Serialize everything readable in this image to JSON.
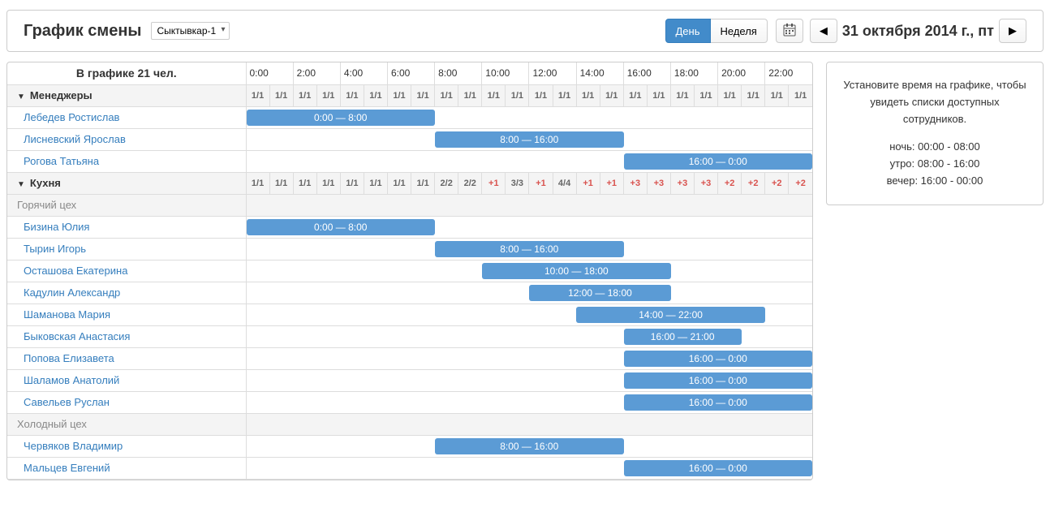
{
  "toolbar": {
    "title": "График смены",
    "location": "Сыктывкар-1",
    "view_day": "День",
    "view_week": "Неделя",
    "date": "31 октября 2014 г., пт"
  },
  "header": {
    "summary": "В графике 21 чел.",
    "times": [
      "0:00",
      "2:00",
      "4:00",
      "6:00",
      "8:00",
      "10:00",
      "12:00",
      "14:00",
      "16:00",
      "18:00",
      "20:00",
      "22:00"
    ]
  },
  "groups": [
    {
      "name": "Менеджеры",
      "counters": [
        {
          "v": "1/1"
        },
        {
          "v": "1/1"
        },
        {
          "v": "1/1"
        },
        {
          "v": "1/1"
        },
        {
          "v": "1/1"
        },
        {
          "v": "1/1"
        },
        {
          "v": "1/1"
        },
        {
          "v": "1/1"
        },
        {
          "v": "1/1"
        },
        {
          "v": "1/1"
        },
        {
          "v": "1/1"
        },
        {
          "v": "1/1"
        },
        {
          "v": "1/1"
        },
        {
          "v": "1/1"
        },
        {
          "v": "1/1"
        },
        {
          "v": "1/1"
        },
        {
          "v": "1/1"
        },
        {
          "v": "1/1"
        },
        {
          "v": "1/1"
        },
        {
          "v": "1/1"
        },
        {
          "v": "1/1"
        },
        {
          "v": "1/1"
        },
        {
          "v": "1/1"
        },
        {
          "v": "1/1"
        }
      ],
      "rows": [
        {
          "name": "Лебедев Ростислав",
          "start": 0,
          "end": 8,
          "label": "0:00 — 8:00"
        },
        {
          "name": "Лисневский Ярослав",
          "start": 8,
          "end": 16,
          "label": "8:00 — 16:00"
        },
        {
          "name": "Рогова Татьяна",
          "start": 16,
          "end": 24,
          "label": "16:00 — 0:00"
        }
      ]
    },
    {
      "name": "Кухня",
      "counters": [
        {
          "v": "1/1"
        },
        {
          "v": "1/1"
        },
        {
          "v": "1/1"
        },
        {
          "v": "1/1"
        },
        {
          "v": "1/1"
        },
        {
          "v": "1/1"
        },
        {
          "v": "1/1"
        },
        {
          "v": "1/1"
        },
        {
          "v": "2/2"
        },
        {
          "v": "2/2"
        },
        {
          "v": "+1",
          "red": true
        },
        {
          "v": "3/3"
        },
        {
          "v": "+1",
          "red": true
        },
        {
          "v": "4/4"
        },
        {
          "v": "+1",
          "red": true
        },
        {
          "v": "+1",
          "red": true
        },
        {
          "v": "+3",
          "red": true
        },
        {
          "v": "+3",
          "red": true
        },
        {
          "v": "+3",
          "red": true
        },
        {
          "v": "+3",
          "red": true
        },
        {
          "v": "+2",
          "red": true
        },
        {
          "v": "+2",
          "red": true
        },
        {
          "v": "+2",
          "red": true
        },
        {
          "v": "+2",
          "red": true
        }
      ],
      "subgroups": [
        {
          "name": "Горячий цех",
          "rows": [
            {
              "name": "Бизина Юлия",
              "start": 0,
              "end": 8,
              "label": "0:00 — 8:00"
            },
            {
              "name": "Тырин Игорь",
              "start": 8,
              "end": 16,
              "label": "8:00 — 16:00"
            },
            {
              "name": "Осташова Екатерина",
              "start": 10,
              "end": 18,
              "label": "10:00 — 18:00"
            },
            {
              "name": "Кадулин Александр",
              "start": 12,
              "end": 18,
              "label": "12:00 — 18:00"
            },
            {
              "name": "Шаманова Мария",
              "start": 14,
              "end": 22,
              "label": "14:00 — 22:00"
            },
            {
              "name": "Быковская Анастасия",
              "start": 16,
              "end": 21,
              "label": "16:00 — 21:00"
            },
            {
              "name": "Попова Елизавета",
              "start": 16,
              "end": 24,
              "label": "16:00 — 0:00"
            },
            {
              "name": "Шаламов Анатолий",
              "start": 16,
              "end": 24,
              "label": "16:00 — 0:00"
            },
            {
              "name": "Савельев Руслан",
              "start": 16,
              "end": 24,
              "label": "16:00 — 0:00"
            }
          ]
        },
        {
          "name": "Холодный цех",
          "rows": [
            {
              "name": "Червяков Владимир",
              "start": 8,
              "end": 16,
              "label": "8:00 — 16:00"
            },
            {
              "name": "Мальцев Евгений",
              "start": 16,
              "end": 24,
              "label": "16:00 — 0:00"
            }
          ]
        }
      ]
    }
  ],
  "side": {
    "hint": "Установите время на графике, чтобы увидеть списки доступных сотрудников.",
    "night": "ночь: 00:00 - 08:00",
    "morning": "утро: 08:00 - 16:00",
    "evening": "вечер: 16:00 - 00:00"
  }
}
